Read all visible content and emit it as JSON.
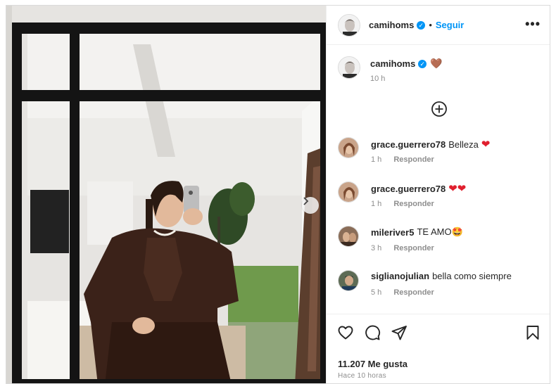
{
  "post": {
    "author": "camihoms",
    "follow_label": "Seguir",
    "separator": "•",
    "more_label": "•••",
    "caption_emoji": "🤎",
    "caption_time": "10 h",
    "likes": "11.207 Me gusta",
    "posted_ago": "Hace 10 horas"
  },
  "comments": [
    {
      "user": "grace.guerrero78",
      "text": "Belleza",
      "emoji": "❤",
      "time": "1 h",
      "reply": "Responder"
    },
    {
      "user": "grace.guerrero78",
      "text": "",
      "emoji": "❤❤",
      "time": "1 h",
      "reply": "Responder"
    },
    {
      "user": "mileriver5",
      "text": "TE AMO🤩",
      "emoji": "",
      "time": "3 h",
      "reply": "Responder"
    },
    {
      "user": "siglianojulian",
      "text": "bella como siempre",
      "emoji": "",
      "time": "5 h",
      "reply": "Responder"
    }
  ],
  "icons": {
    "like": "heart-outline",
    "comment": "speech-bubble",
    "share": "paper-plane",
    "save": "bookmark",
    "load_more": "plus-circle",
    "next": "chevron-right"
  },
  "colors": {
    "accent": "#0095f6",
    "heart": "#e0202e",
    "muted": "#8e8e8e"
  }
}
